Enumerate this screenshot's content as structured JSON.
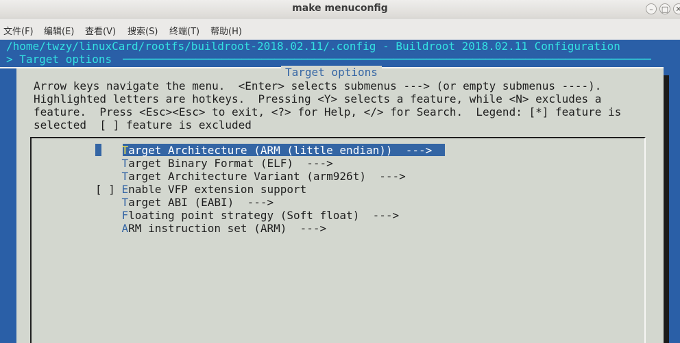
{
  "window": {
    "title": "make menuconfig",
    "buttons": [
      "–",
      "□",
      "✕"
    ]
  },
  "menubar": [
    {
      "label": "文件(F)"
    },
    {
      "label": "编辑(E)"
    },
    {
      "label": "查看(V)"
    },
    {
      "label": "搜索(S)"
    },
    {
      "label": "终端(T)"
    },
    {
      "label": "帮助(H)"
    }
  ],
  "terminal": {
    "header": "/home/twzy/linuxCard/rootfs/buildroot-2018.02.11/.config - Buildroot 2018.02.11 Configuration",
    "breadcrumb": "> Target options",
    "rule": "────────────────────────────────────────────────────────────────────────────────"
  },
  "dialog": {
    "title": "Target options",
    "help_lines": [
      "Arrow keys navigate the menu.  <Enter> selects submenus ---> (or empty submenus ----).",
      "Highlighted letters are hotkeys.  Pressing <Y> selects a feature, while <N> excludes a",
      "feature.  Press <Esc><Esc> to exit, <?> for Help, </> for Search.  Legend: [*] feature is",
      "selected  [ ] feature is excluded"
    ],
    "items": [
      {
        "prefix": "    ",
        "hotkey": "T",
        "rest": "arget Architecture (ARM (little endian))  --->",
        "selected": true
      },
      {
        "prefix": "    ",
        "hotkey": "T",
        "rest": "arget Binary Format (ELF)  --->",
        "selected": false
      },
      {
        "prefix": "    ",
        "hotkey": "T",
        "rest": "arget Architecture Variant (arm926t)  --->",
        "selected": false
      },
      {
        "prefix": "[ ] ",
        "hotkey": "E",
        "rest": "nable VFP extension support",
        "selected": false
      },
      {
        "prefix": "    ",
        "hotkey": "T",
        "rest": "arget ABI (EABI)  --->",
        "selected": false
      },
      {
        "prefix": "    ",
        "hotkey": "F",
        "rest": "loating point strategy (Soft float)  --->",
        "selected": false
      },
      {
        "prefix": "    ",
        "hotkey": "A",
        "rest": "RM instruction set (ARM)  --->",
        "selected": false
      }
    ]
  },
  "colors": {
    "terminal_bg": "#2a5fa7",
    "dialog_bg": "#d3d7cf",
    "accent": "#3465a4",
    "hotkey_selected": "#fce94f",
    "header_text": "#34e2e2"
  }
}
